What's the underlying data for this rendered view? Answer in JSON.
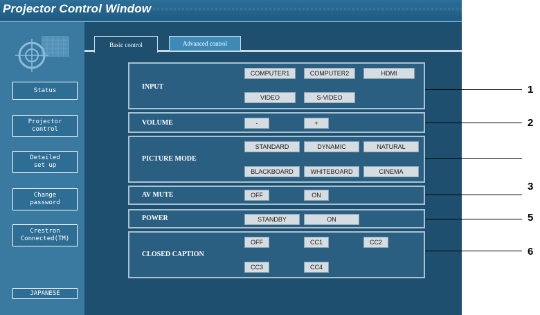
{
  "window": {
    "title": "Projector Control Window"
  },
  "sidebar": {
    "items": [
      {
        "label": "Status"
      },
      {
        "label": "Projector\ncontrol"
      },
      {
        "label": "Detailed\nset up"
      },
      {
        "label": "Change\npassword"
      },
      {
        "label": "Crestron\nConnected(TM)"
      },
      {
        "label": "JAPANESE"
      }
    ]
  },
  "tabs": [
    {
      "label": "Basic control"
    },
    {
      "label": "Advanced control"
    }
  ],
  "sections": {
    "input": {
      "label": "INPUT",
      "buttons": [
        "COMPUTER1",
        "COMPUTER2",
        "HDMI",
        "VIDEO",
        "S-VIDEO"
      ]
    },
    "volume": {
      "label": "VOLUME",
      "buttons": [
        "-",
        "+"
      ]
    },
    "picture_mode": {
      "label": "PICTURE MODE",
      "buttons": [
        "STANDARD",
        "DYNAMIC",
        "NATURAL",
        "BLACKBOARD",
        "WHITEBOARD",
        "CINEMA"
      ]
    },
    "av_mute": {
      "label": "AV MUTE",
      "buttons": [
        "OFF",
        "ON"
      ]
    },
    "power": {
      "label": "POWER",
      "buttons": [
        "STANDBY",
        "ON"
      ]
    },
    "closed_caption": {
      "label": "CLOSED CAPTION",
      "buttons": [
        "OFF",
        "CC1",
        "CC2",
        "CC3",
        "CC4"
      ]
    }
  },
  "callouts": [
    "1",
    "2",
    "3",
    "5",
    "6"
  ],
  "colors": {
    "window_bg": "#1f4f6e",
    "sidebar_bg": "#3a7aa0",
    "button_bg": "#d6dde2",
    "tab_inactive": "#3d8ab8"
  }
}
